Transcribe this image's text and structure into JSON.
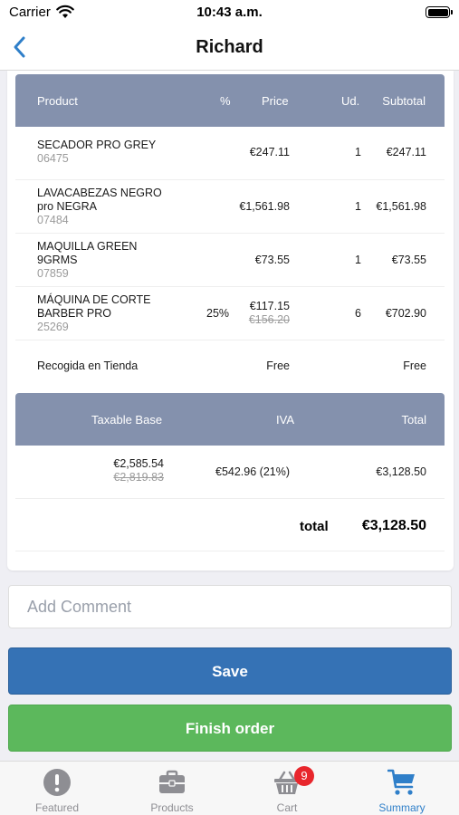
{
  "status_bar": {
    "carrier": "Carrier",
    "time": "10:43 a.m."
  },
  "nav": {
    "title": "Richard"
  },
  "order_table": {
    "headers": {
      "product": "Product",
      "percent": "%",
      "price": "Price",
      "units": "Ud.",
      "subtotal": "Subtotal"
    },
    "rows": [
      {
        "name": "SECADOR PRO GREY",
        "code": "06475",
        "discount": "",
        "price": "€247.11",
        "original_price": "",
        "units": "1",
        "subtotal": "€247.11"
      },
      {
        "name": "LAVACABEZAS NEGRO pro NEGRA",
        "code": "07484",
        "discount": "",
        "price": "€1,561.98",
        "original_price": "",
        "units": "1",
        "subtotal": "€1,561.98"
      },
      {
        "name": "MAQUILLA GREEN 9GRMS",
        "code": "07859",
        "discount": "",
        "price": "€73.55",
        "original_price": "",
        "units": "1",
        "subtotal": "€73.55"
      },
      {
        "name": "MÁQUINA DE CORTE BARBER PRO",
        "code": "25269",
        "discount": "25%",
        "price": "€117.15",
        "original_price": "€156.20",
        "units": "6",
        "subtotal": "€702.90"
      }
    ],
    "shipping": {
      "label": "Recogida en Tienda",
      "price": "Free",
      "subtotal": "Free"
    }
  },
  "totals_table": {
    "headers": {
      "taxable_base": "Taxable Base",
      "iva": "IVA",
      "total": "Total"
    },
    "taxable_base": "€2,585.54",
    "taxable_base_original": "€2,819.83",
    "iva": "€542.96 (21%)",
    "total": "€3,128.50",
    "grand_total_label": "total",
    "grand_total_value": "€3,128.50"
  },
  "comment": {
    "placeholder": "Add Comment",
    "value": ""
  },
  "buttons": {
    "save": "Save",
    "finish": "Finish order"
  },
  "tab_bar": {
    "tabs": [
      {
        "label": "Featured",
        "icon": "exclamation-circle-icon"
      },
      {
        "label": "Products",
        "icon": "briefcase-icon"
      },
      {
        "label": "Cart",
        "icon": "basket-icon",
        "badge": "9"
      },
      {
        "label": "Summary",
        "icon": "cart-icon"
      }
    ],
    "active": "Summary"
  },
  "colors": {
    "header_bg": "#8491ad",
    "accent": "#2f7fc9",
    "save_button": "#3572b5",
    "finish_button": "#5cb85c",
    "badge": "#e8262c"
  }
}
